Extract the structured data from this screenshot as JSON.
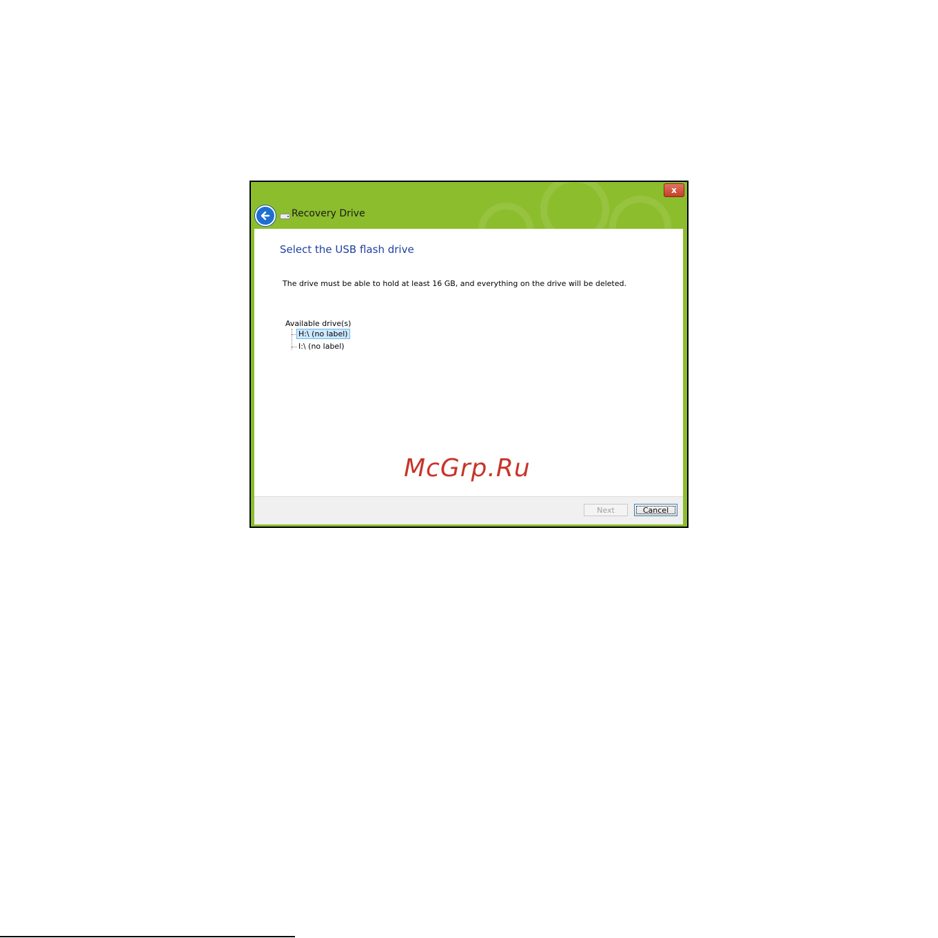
{
  "window": {
    "title": "Recovery Drive",
    "close_label": "x",
    "accent_color": "#8cbd2c"
  },
  "page": {
    "heading": "Select the USB flash drive",
    "description": "The drive must be able to hold at least 16 GB, and everything on the drive will be deleted."
  },
  "drives": {
    "label": "Available drive(s)",
    "items": [
      {
        "label": "H:\\ (no label)",
        "selected": true
      },
      {
        "label": "I:\\ (no label)",
        "selected": false
      }
    ]
  },
  "watermark": "McGrp.Ru",
  "footer": {
    "next_label": "Next",
    "cancel_label": "Cancel"
  },
  "icons": {
    "back": "back-arrow-icon",
    "drive": "usb-drive-icon",
    "close": "close-icon"
  }
}
